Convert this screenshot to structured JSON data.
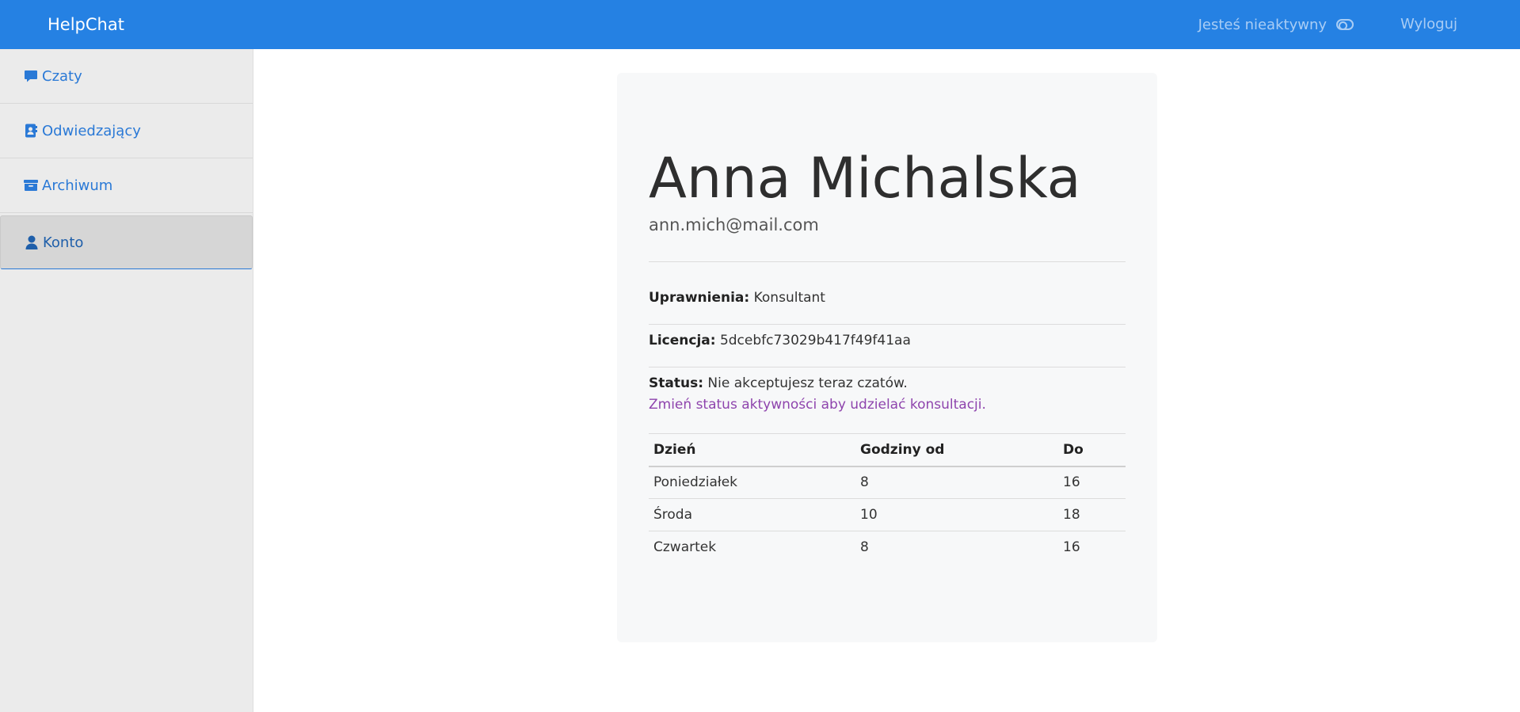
{
  "navbar": {
    "brand": "HelpChat",
    "status_label": "Jesteś nieaktywny",
    "logout_label": "Wyloguj",
    "background_color": "#2581e3"
  },
  "sidebar": {
    "items": [
      {
        "label": "Czaty",
        "icon": "chat-bubble-icon",
        "active": false
      },
      {
        "label": "Odwiedzający",
        "icon": "contact-card-icon",
        "active": false
      },
      {
        "label": "Archiwum",
        "icon": "archive-box-icon",
        "active": false
      },
      {
        "label": "Konto",
        "icon": "user-icon",
        "active": true
      }
    ]
  },
  "profile": {
    "name": "Anna Michalska",
    "email": "ann.mich@mail.com",
    "permissions_label": "Uprawnienia:",
    "permissions_value": "Konsultant",
    "license_label": "Licencja:",
    "license_value": "5dcebfc73029b417f49f41aa",
    "status_label": "Status:",
    "status_value": "Nie akceptujesz teraz czatów.",
    "status_link": "Zmień status aktywności aby udzielać konsultacji.",
    "link_color": "#8e44ad"
  },
  "schedule": {
    "headers": [
      "Dzień",
      "Godziny od",
      "Do"
    ],
    "rows": [
      [
        "Poniedziałek",
        "8",
        "16"
      ],
      [
        "Środa",
        "10",
        "18"
      ],
      [
        "Czwartek",
        "8",
        "16"
      ]
    ]
  }
}
